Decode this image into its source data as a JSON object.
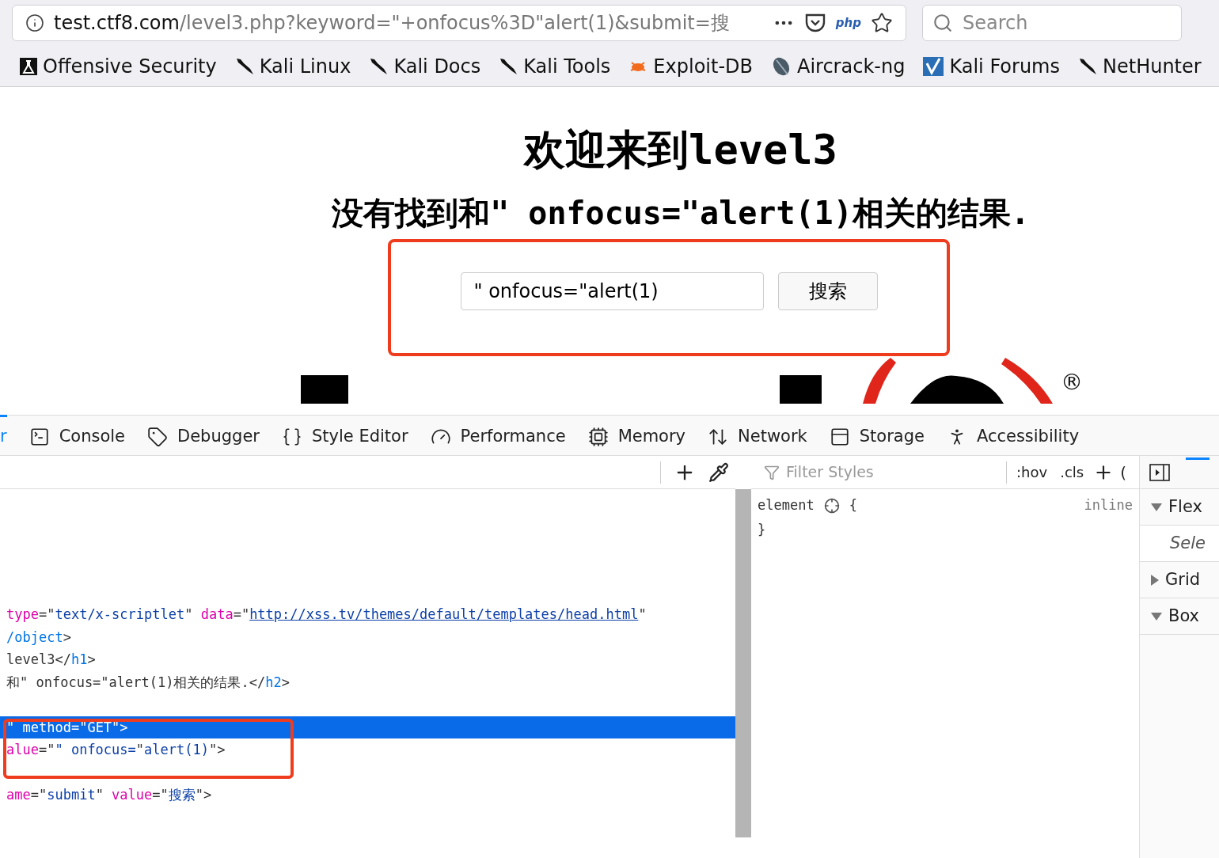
{
  "browser": {
    "url": {
      "host": "test.ctf8.com",
      "path": "/level3.php?keyword=\"+onfocus%3D\"alert(1)&submit=搜"
    },
    "php_badge": "php",
    "search": {
      "placeholder": "Search"
    }
  },
  "bookmarks": [
    {
      "label": "Offensive Security"
    },
    {
      "label": "Kali Linux"
    },
    {
      "label": "Kali Docs"
    },
    {
      "label": "Kali Tools"
    },
    {
      "label": "Exploit-DB"
    },
    {
      "label": "Aircrack-ng"
    },
    {
      "label": "Kali Forums"
    },
    {
      "label": "NetHunter"
    }
  ],
  "page": {
    "heading": "欢迎来到level3",
    "result": "没有找到和\" onfocus=\"alert(1)相关的结果.",
    "form": {
      "value": "\" onfocus=\"alert(1)",
      "button": "搜索"
    },
    "logo_mark": "®"
  },
  "devtools": {
    "tabs": [
      {
        "label": "r",
        "selected": true
      },
      {
        "label": "Console",
        "selected": false
      },
      {
        "label": "Debugger",
        "selected": false
      },
      {
        "label": "Style Editor",
        "selected": false
      },
      {
        "label": "Performance",
        "selected": false
      },
      {
        "label": "Memory",
        "selected": false
      },
      {
        "label": "Network",
        "selected": false
      },
      {
        "label": "Storage",
        "selected": false
      },
      {
        "label": "Accessibility",
        "selected": false
      }
    ],
    "markup": [
      {
        "selected": false,
        "segments": [
          {
            "kind": "attr",
            "text": "type"
          },
          {
            "kind": "plain",
            "text": "=\""
          },
          {
            "kind": "value",
            "text": "text/x-scriptlet"
          },
          {
            "kind": "plain",
            "text": "\" "
          },
          {
            "kind": "attr",
            "text": "data"
          },
          {
            "kind": "plain",
            "text": "=\""
          },
          {
            "kind": "link",
            "text": "http://xss.tv/themes/default/templates/head.html"
          },
          {
            "kind": "plain",
            "text": "\""
          }
        ]
      },
      {
        "selected": false,
        "segments": [
          {
            "kind": "tag",
            "text": "/object"
          },
          {
            "kind": "plain",
            "text": ">"
          }
        ]
      },
      {
        "selected": false,
        "segments": [
          {
            "kind": "plain",
            "text": "level3</"
          },
          {
            "kind": "tag",
            "text": "h1"
          },
          {
            "kind": "plain",
            "text": ">"
          }
        ]
      },
      {
        "selected": false,
        "segments": [
          {
            "kind": "plain",
            "text": "和\" onfocus=\"alert(1)相关的结果.</"
          },
          {
            "kind": "tag",
            "text": "h2"
          },
          {
            "kind": "plain",
            "text": ">"
          }
        ]
      },
      {
        "selected": true,
        "segments": [
          {
            "kind": "plain",
            "text": "\" "
          },
          {
            "kind": "attr",
            "text": "method"
          },
          {
            "kind": "plain",
            "text": "=\""
          },
          {
            "kind": "value",
            "text": "GET"
          },
          {
            "kind": "plain",
            "text": "\">"
          }
        ]
      },
      {
        "selected": false,
        "segments": [
          {
            "kind": "attr",
            "text": "alue"
          },
          {
            "kind": "plain",
            "text": "=\""
          },
          {
            "kind": "value",
            "text": "\" onfocus="
          },
          {
            "kind": "plain",
            "text": "\""
          },
          {
            "kind": "value",
            "text": "alert(1)"
          },
          {
            "kind": "plain",
            "text": "\">"
          }
        ]
      },
      {
        "selected": false,
        "segments": [
          {
            "kind": "attr",
            "text": "ame"
          },
          {
            "kind": "plain",
            "text": "=\""
          },
          {
            "kind": "value",
            "text": "submit"
          },
          {
            "kind": "plain",
            "text": "\" "
          },
          {
            "kind": "attr",
            "text": "value"
          },
          {
            "kind": "plain",
            "text": "=\""
          },
          {
            "kind": "value",
            "text": "搜索"
          },
          {
            "kind": "plain",
            "text": "\">"
          }
        ]
      }
    ],
    "rules": {
      "filter_placeholder": "Filter Styles",
      "hov": ":hov",
      "cls": ".cls",
      "paren": "(",
      "selector": "element",
      "open": "{",
      "close": "}",
      "source": "inline"
    },
    "layout_panel": {
      "sections": [
        {
          "label": "Flex",
          "expanded": true
        },
        {
          "label": "Sele",
          "kind": "note"
        },
        {
          "label": "Grid",
          "expanded": false
        },
        {
          "label": "Box",
          "expanded": true
        }
      ]
    }
  }
}
